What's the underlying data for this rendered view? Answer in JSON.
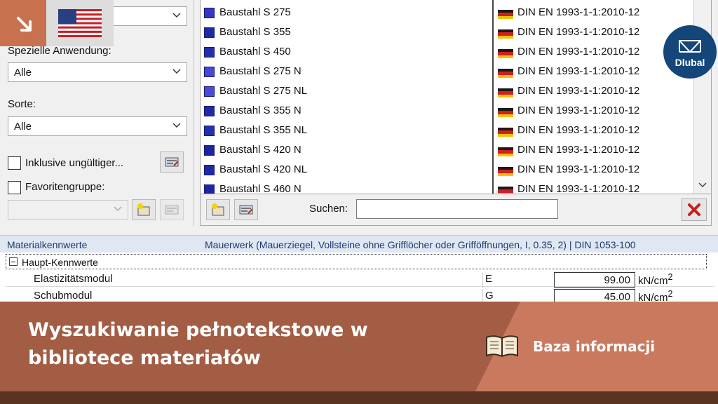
{
  "filters": {
    "top_dropdown_value": "",
    "special_application_label": "Spezielle Anwendung:",
    "special_application_value": "Alle",
    "grade_label": "Sorte:",
    "grade_value": "Alle",
    "include_invalid_label": "Inklusive ungültiger...",
    "favorites_label": "Favoritengruppe:",
    "favorites_value": ""
  },
  "materials": [
    {
      "name": "Baustahl S 275",
      "norm": "DIN EN 1993-1-1:2010-12",
      "color": "#3636c8"
    },
    {
      "name": "Baustahl S 355",
      "norm": "DIN EN 1993-1-1:2010-12",
      "color": "#1e2aa6"
    },
    {
      "name": "Baustahl S 450",
      "norm": "DIN EN 1993-1-1:2010-12",
      "color": "#2230b0"
    },
    {
      "name": "Baustahl S 275 N",
      "norm": "DIN EN 1993-1-1:2010-12",
      "color": "#4646d8"
    },
    {
      "name": "Baustahl S 275 NL",
      "norm": "DIN EN 1993-1-1:2010-12",
      "color": "#4a4ad8"
    },
    {
      "name": "Baustahl S 355 N",
      "norm": "DIN EN 1993-1-1:2010-12",
      "color": "#1e2aa6"
    },
    {
      "name": "Baustahl S 355 NL",
      "norm": "DIN EN 1993-1-1:2010-12",
      "color": "#2430b2"
    },
    {
      "name": "Baustahl S 420 N",
      "norm": "DIN EN 1993-1-1:2010-12",
      "color": "#1a24a0"
    },
    {
      "name": "Baustahl S 420 NL",
      "norm": "DIN EN 1993-1-1:2010-12",
      "color": "#1e28a8"
    },
    {
      "name": "Baustahl S 460 N",
      "norm": "DIN EN 1993-1-1:2010-12",
      "color": "#1c26a4"
    }
  ],
  "search": {
    "label": "Suchen:",
    "value": ""
  },
  "properties": {
    "header_left": "Materialkennwerte",
    "header_right": "Mauerwerk (Mauerziegel, Vollsteine ohne Grifflöcher oder Grifföffnungen, I, 0.35, 2) | DIN 1053-100",
    "group": "Haupt-Kennwerte",
    "rows": [
      {
        "name": "Elastizitätsmodul",
        "symbol": "E",
        "value": "99.00",
        "unit": "kN/cm",
        "unit_exp": "2"
      },
      {
        "name": "Schubmodul",
        "symbol": "G",
        "value": "45.00",
        "unit": "kN/cm",
        "unit_exp": "2"
      }
    ]
  },
  "overlay": {
    "logo_text": "Dlubal",
    "banner_title": "Wyszukiwanie pełnotekstowe w bibliotece materiałów",
    "kb_label": "Baza informacji"
  },
  "icons": [
    "arrow-down-right-icon",
    "us-flag-icon",
    "dlubal-logo-icon",
    "new-folder-icon",
    "edit-icon",
    "delete-x-icon",
    "chevron-down-icon",
    "book-icon",
    "germany-flag-icon"
  ],
  "colors": {
    "banner": "#a35d44",
    "banner_accent": "#c97a5e",
    "corner_tag": "#c8714f",
    "logo": "#14467a",
    "header_bg": "#dfe7f3"
  }
}
